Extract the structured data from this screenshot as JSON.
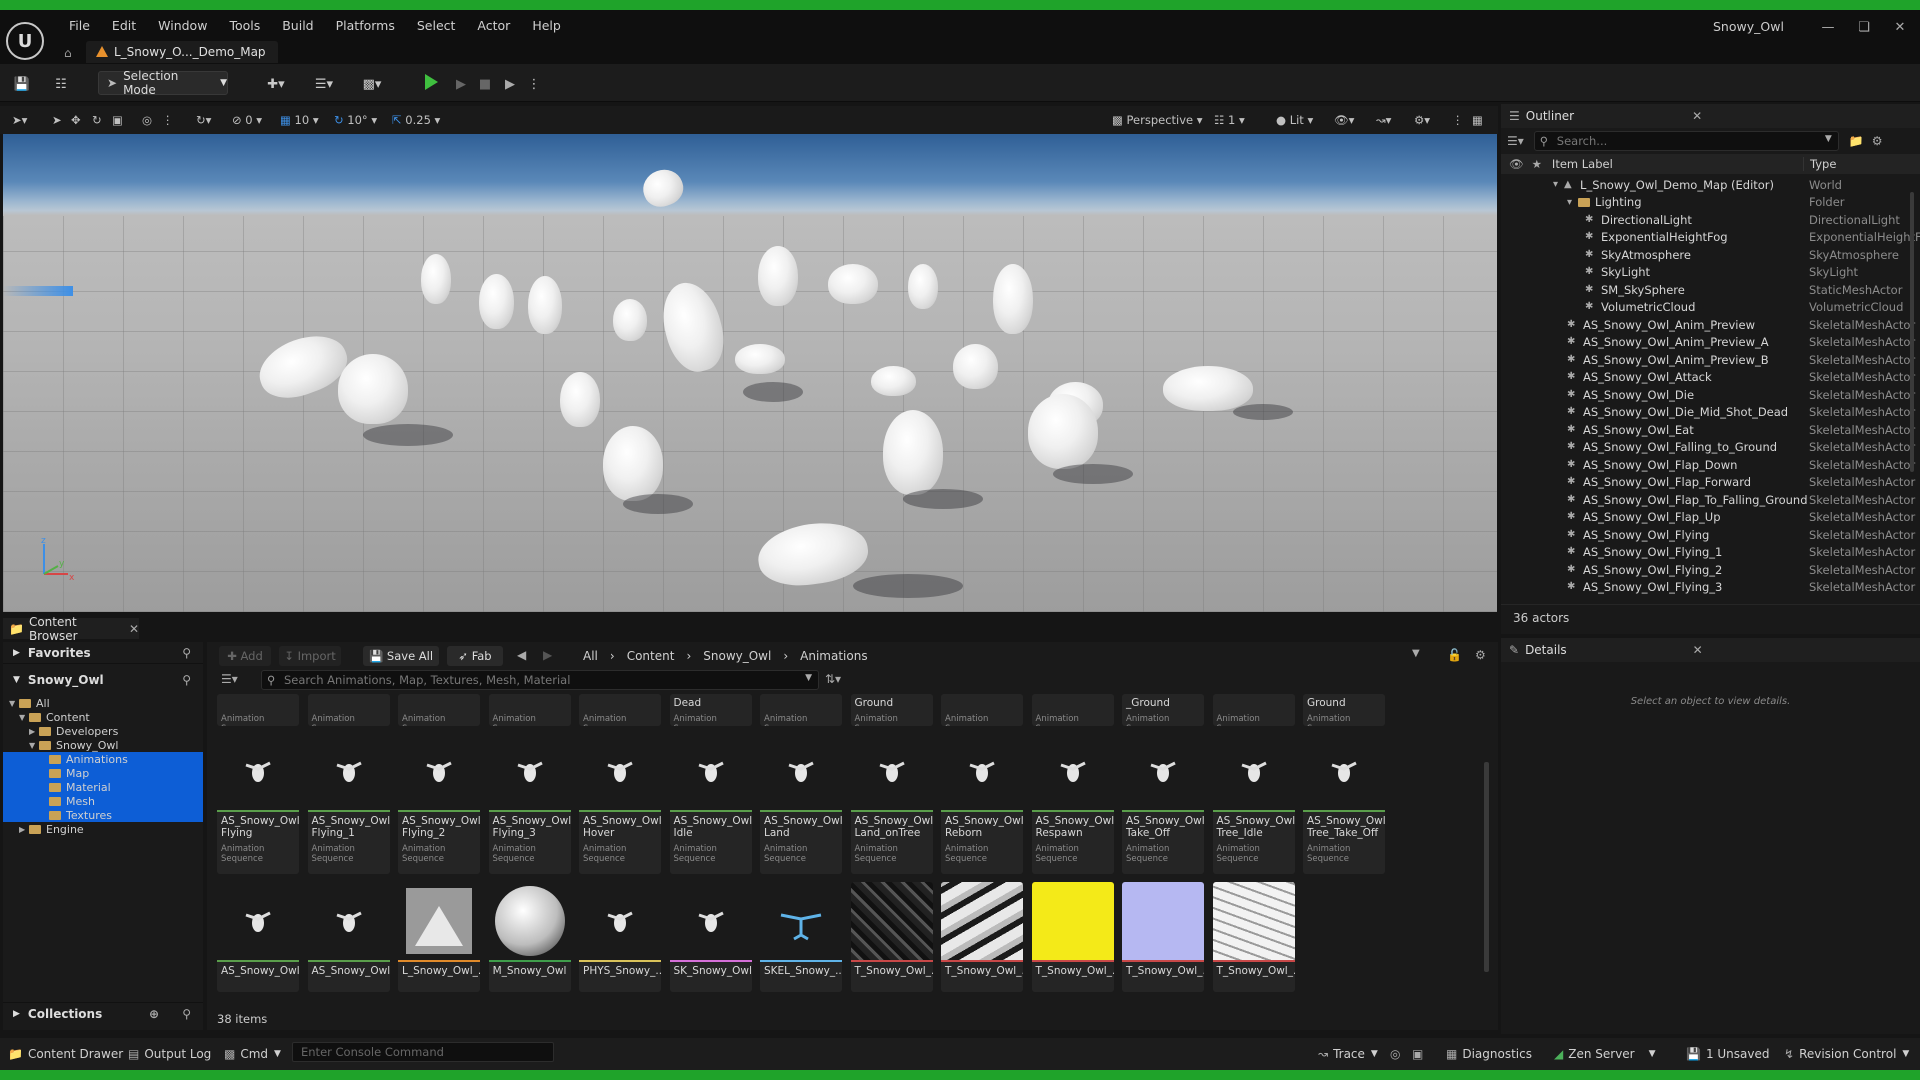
{
  "app": {
    "window_title": "Snowy_Owl",
    "map_tab": "L_Snowy_O..._Demo_Map"
  },
  "menu": [
    "File",
    "Edit",
    "Window",
    "Tools",
    "Build",
    "Platforms",
    "Select",
    "Actor",
    "Help"
  ],
  "toolbar": {
    "selection_mode": "Selection Mode"
  },
  "viewport_toolbar": {
    "grid_snap": "10",
    "rot_snap": "10°",
    "scale_snap": "0.25",
    "translate_count": "0",
    "perspective": "Perspective",
    "views": "1",
    "lit": "Lit"
  },
  "outliner": {
    "title": "Outliner",
    "search_placeholder": "Search...",
    "col_label": "Item Label",
    "col_type": "Type",
    "rows": [
      {
        "label": "L_Snowy_Owl_Demo_Map (Editor)",
        "type": "World"
      },
      {
        "label": "Lighting",
        "type": "Folder"
      },
      {
        "label": "DirectionalLight",
        "type": "DirectionalLight"
      },
      {
        "label": "ExponentialHeightFog",
        "type": "ExponentialHeightF"
      },
      {
        "label": "SkyAtmosphere",
        "type": "SkyAtmosphere"
      },
      {
        "label": "SkyLight",
        "type": "SkyLight"
      },
      {
        "label": "SM_SkySphere",
        "type": "StaticMeshActor"
      },
      {
        "label": "VolumetricCloud",
        "type": "VolumetricCloud"
      },
      {
        "label": "AS_Snowy_Owl_Anim_Preview",
        "type": "SkeletalMeshActor"
      },
      {
        "label": "AS_Snowy_Owl_Anim_Preview_A",
        "type": "SkeletalMeshActor"
      },
      {
        "label": "AS_Snowy_Owl_Anim_Preview_B",
        "type": "SkeletalMeshActor"
      },
      {
        "label": "AS_Snowy_Owl_Attack",
        "type": "SkeletalMeshActor"
      },
      {
        "label": "AS_Snowy_Owl_Die",
        "type": "SkeletalMeshActor"
      },
      {
        "label": "AS_Snowy_Owl_Die_Mid_Shot_Dead",
        "type": "SkeletalMeshActor"
      },
      {
        "label": "AS_Snowy_Owl_Eat",
        "type": "SkeletalMeshActor"
      },
      {
        "label": "AS_Snowy_Owl_Falling_to_Ground",
        "type": "SkeletalMeshActor"
      },
      {
        "label": "AS_Snowy_Owl_Flap_Down",
        "type": "SkeletalMeshActor"
      },
      {
        "label": "AS_Snowy_Owl_Flap_Forward",
        "type": "SkeletalMeshActor"
      },
      {
        "label": "AS_Snowy_Owl_Flap_To_Falling_Ground",
        "type": "SkeletalMeshActor"
      },
      {
        "label": "AS_Snowy_Owl_Flap_Up",
        "type": "SkeletalMeshActor"
      },
      {
        "label": "AS_Snowy_Owl_Flying",
        "type": "SkeletalMeshActor"
      },
      {
        "label": "AS_Snowy_Owl_Flying_1",
        "type": "SkeletalMeshActor"
      },
      {
        "label": "AS_Snowy_Owl_Flying_2",
        "type": "SkeletalMeshActor"
      },
      {
        "label": "AS_Snowy_Owl_Flying_3",
        "type": "SkeletalMeshActor"
      }
    ],
    "actor_count": "36 actors"
  },
  "details": {
    "title": "Details",
    "empty_msg": "Select an object to view details."
  },
  "content_browser": {
    "tab": "Content Browser",
    "favorites": "Favorites",
    "project": "Snowy_Owl",
    "collections": "Collections",
    "tree": [
      {
        "label": "All",
        "depth": 0,
        "selected": false
      },
      {
        "label": "Content",
        "depth": 1,
        "selected": false
      },
      {
        "label": "Developers",
        "depth": 2,
        "selected": false
      },
      {
        "label": "Snowy_Owl",
        "depth": 2,
        "selected": false
      },
      {
        "label": "Animations",
        "depth": 3,
        "selected": true
      },
      {
        "label": "Map",
        "depth": 3,
        "selected": true
      },
      {
        "label": "Material",
        "depth": 3,
        "selected": true
      },
      {
        "label": "Mesh",
        "depth": 3,
        "selected": true
      },
      {
        "label": "Textures",
        "depth": 3,
        "selected": true
      },
      {
        "label": "Engine",
        "depth": 1,
        "selected": false
      }
    ],
    "buttons": {
      "add": "Add",
      "import": "Import",
      "save_all": "Save All",
      "fab": "Fab"
    },
    "breadcrumb": [
      "All",
      "Content",
      "Snowy_Owl",
      "Animations"
    ],
    "search_placeholder": "Search Animations, Map, Textures, Mesh, Material",
    "item_count": "38 items",
    "row0": [
      {
        "name": "",
        "type": "Animation Sequence"
      },
      {
        "name": "",
        "type": "Animation Sequence"
      },
      {
        "name": "",
        "type": "Animation Sequence"
      },
      {
        "name": "",
        "type": "Animation Sequence"
      },
      {
        "name": "",
        "type": "Animation Sequence"
      },
      {
        "name": "Dead",
        "type": "Animation Sequence"
      },
      {
        "name": "",
        "type": "Animation Sequence"
      },
      {
        "name": "Ground",
        "type": "Animation Sequence"
      },
      {
        "name": "",
        "type": "Animation Sequence"
      },
      {
        "name": "",
        "type": "Animation Sequence"
      },
      {
        "name": "_Ground",
        "type": "Animation Sequence"
      },
      {
        "name": "",
        "type": "Animation Sequence"
      },
      {
        "name": "Ground",
        "type": "Animation Sequence"
      }
    ],
    "row1": [
      {
        "name": "AS_Snowy_Owl_ Flying",
        "type": "Animation Sequence"
      },
      {
        "name": "AS_Snowy_Owl_ Flying_1",
        "type": "Animation Sequence"
      },
      {
        "name": "AS_Snowy_Owl_ Flying_2",
        "type": "Animation Sequence"
      },
      {
        "name": "AS_Snowy_Owl_ Flying_3",
        "type": "Animation Sequence"
      },
      {
        "name": "AS_Snowy_Owl_ Hover",
        "type": "Animation Sequence"
      },
      {
        "name": "AS_Snowy_Owl_ Idle",
        "type": "Animation Sequence"
      },
      {
        "name": "AS_Snowy_Owl_ Land",
        "type": "Animation Sequence"
      },
      {
        "name": "AS_Snowy_Owl_ Land_onTree",
        "type": "Animation Sequence"
      },
      {
        "name": "AS_Snowy_Owl_ Reborn",
        "type": "Animation Sequence"
      },
      {
        "name": "AS_Snowy_Owl_ Respawn",
        "type": "Animation Sequence"
      },
      {
        "name": "AS_Snowy_Owl_ Take_Off",
        "type": "Animation Sequence"
      },
      {
        "name": "AS_Snowy_Owl_ Tree_Idle",
        "type": "Animation Sequence"
      },
      {
        "name": "AS_Snowy_Owl_ Tree_Take_Off",
        "type": "Animation Sequence"
      }
    ],
    "row2": [
      {
        "name": "AS_Snowy_Owl_...",
        "kind": "anim",
        "line": "#5a9e4b"
      },
      {
        "name": "AS_Snowy_Owl_...",
        "kind": "anim",
        "line": "#5a9e4b"
      },
      {
        "name": "L_Snowy_Owl_...",
        "kind": "map",
        "line": "#e08a2a"
      },
      {
        "name": "M_Snowy_Owl",
        "kind": "material",
        "line": "#3f9e4b"
      },
      {
        "name": "PHYS_Snowy_...",
        "kind": "phys",
        "line": "#d9c25a"
      },
      {
        "name": "SK_Snowy_Owl",
        "kind": "skel",
        "line": "#d56fd8"
      },
      {
        "name": "SKEL_Snowy_...",
        "kind": "skeleton",
        "line": "#5fb3e8"
      },
      {
        "name": "T_Snowy_Owl_...",
        "kind": "tex-dark",
        "line": "#c84848"
      },
      {
        "name": "T_Snowy_Owl_...",
        "kind": "tex-bw",
        "line": "#c84848"
      },
      {
        "name": "T_Snowy_Owl_...",
        "kind": "tex-yellow",
        "line": "#c84848"
      },
      {
        "name": "T_Snowy_Owl_...",
        "kind": "tex-blue",
        "line": "#c84848"
      },
      {
        "name": "T_Snowy_Owl_...",
        "kind": "tex-white",
        "line": "#c84848"
      }
    ]
  },
  "statusbar": {
    "content_drawer": "Content Drawer",
    "output_log": "Output Log",
    "cmd": "Cmd",
    "console_placeholder": "Enter Console Command",
    "trace": "Trace",
    "diagnostics": "Diagnostics",
    "zen": "Zen Server",
    "unsaved": "1 Unsaved",
    "revision": "Revision Control"
  },
  "colors": {
    "accent_blue": "#0d5ed6",
    "play_green": "#3fbf3f",
    "frame_green": "#1fa32a"
  }
}
